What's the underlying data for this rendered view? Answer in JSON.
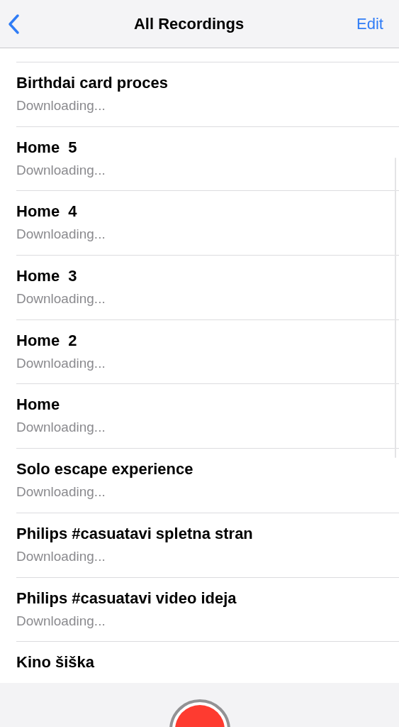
{
  "nav_bar": {
    "title": "All Recordings",
    "edit": "Edit"
  },
  "recordings": [
    {
      "title": "Birthdai card proces",
      "status": "Downloading..."
    },
    {
      "title": "Home  5",
      "status": "Downloading..."
    },
    {
      "title": "Home  4",
      "status": "Downloading..."
    },
    {
      "title": "Home  3",
      "status": "Downloading..."
    },
    {
      "title": "Home  2",
      "status": "Downloading..."
    },
    {
      "title": "Home",
      "status": "Downloading..."
    },
    {
      "title": "Solo escape experience",
      "status": "Downloading..."
    },
    {
      "title": "Philips #casuatavi spletna stran",
      "status": "Downloading..."
    },
    {
      "title": "Philips #casuatavi video ideja",
      "status": "Downloading..."
    },
    {
      "title": "Kino šiška"
    }
  ]
}
